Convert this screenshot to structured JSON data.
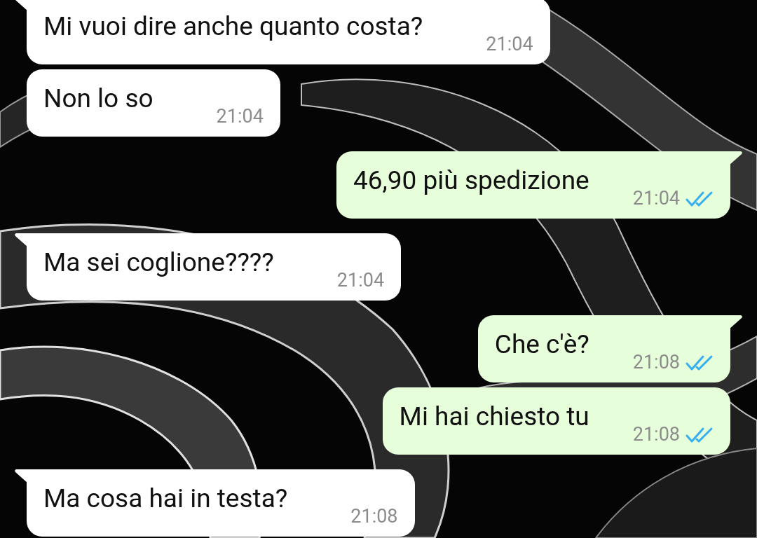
{
  "messages": [
    {
      "kind": "in",
      "tail": true,
      "text": "Mi vuoi dire anche quanto costa?",
      "time": "21:04"
    },
    {
      "kind": "in",
      "tail": false,
      "text": "Non lo so",
      "time": "21:04"
    },
    {
      "kind": "out",
      "tail": true,
      "text": "46,90 più spedizione",
      "time": "21:04",
      "read": true
    },
    {
      "kind": "in",
      "tail": true,
      "text": "Ma sei coglione????",
      "time": "21:04"
    },
    {
      "kind": "out",
      "tail": true,
      "text": "Che c'è?",
      "time": "21:08",
      "read": true
    },
    {
      "kind": "out",
      "tail": false,
      "text": "Mi hai chiesto tu",
      "time": "21:08",
      "read": true
    },
    {
      "kind": "in",
      "tail": true,
      "text": "Ma cosa hai in testa?",
      "time": "21:08"
    }
  ]
}
